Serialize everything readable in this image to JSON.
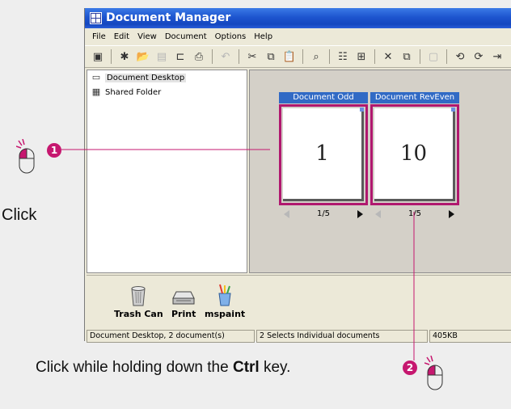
{
  "window": {
    "title": "Document Manager",
    "menu": [
      "File",
      "Edit",
      "View",
      "Document",
      "Options",
      "Help"
    ]
  },
  "toolbar": [
    {
      "icon": "save-icon",
      "glyph": "▣"
    },
    {
      "icon": "new-icon",
      "glyph": "✱"
    },
    {
      "icon": "open-folder-icon",
      "glyph": "📂"
    },
    {
      "icon": "disk-icon",
      "glyph": "▤",
      "dim": true
    },
    {
      "icon": "scan-icon",
      "glyph": "⊏"
    },
    {
      "icon": "print-icon",
      "glyph": "⎙"
    },
    {
      "icon": "undo-icon",
      "glyph": "↶",
      "dim": true
    },
    {
      "icon": "cut-icon",
      "glyph": "✂"
    },
    {
      "icon": "copy-icon",
      "glyph": "⧉"
    },
    {
      "icon": "paste-icon",
      "glyph": "📋"
    },
    {
      "icon": "zoom-icon",
      "glyph": "⌕"
    },
    {
      "icon": "view-list-icon",
      "glyph": "☷"
    },
    {
      "icon": "thumbnails-icon",
      "glyph": "⊞"
    },
    {
      "icon": "delete-icon",
      "glyph": "✕"
    },
    {
      "icon": "duplicate-icon",
      "glyph": "⧉"
    },
    {
      "icon": "disabled-icon",
      "glyph": "▢",
      "dim": true
    },
    {
      "icon": "rotate-left-icon",
      "glyph": "⟲"
    },
    {
      "icon": "rotate-right-icon",
      "glyph": "⟳"
    },
    {
      "icon": "next-page-icon",
      "glyph": "⇥"
    }
  ],
  "tree": {
    "items": [
      {
        "label": "Document Desktop",
        "icon": "desktop-icon",
        "glyph": "▭"
      },
      {
        "label": "Shared Folder",
        "icon": "shared-folder-icon",
        "glyph": "▦"
      }
    ]
  },
  "documents": [
    {
      "title": "Document Odd",
      "page_label": "1",
      "pager": "1/5"
    },
    {
      "title": "Document RevEven",
      "page_label": "10",
      "pager": "1/5"
    }
  ],
  "tray": [
    {
      "label": "Trash Can",
      "icon": "trash-can-icon"
    },
    {
      "label": "Print",
      "icon": "printer-icon"
    },
    {
      "label": "mspaint",
      "icon": "mspaint-icon"
    }
  ],
  "status": {
    "location": "Document Desktop, 2 document(s)",
    "selection": "2 Selects Individual documents",
    "size": "405KB"
  },
  "callouts": {
    "step1_badge": "1",
    "step1_text": "Click",
    "step2_badge": "2",
    "step2_text_before": "Click while holding down the ",
    "step2_key": "Ctrl",
    "step2_text_after": " key."
  },
  "colors": {
    "accent": "#c6176f",
    "titlebar": "#1d55cf",
    "selection_frame": "#b0186f"
  }
}
